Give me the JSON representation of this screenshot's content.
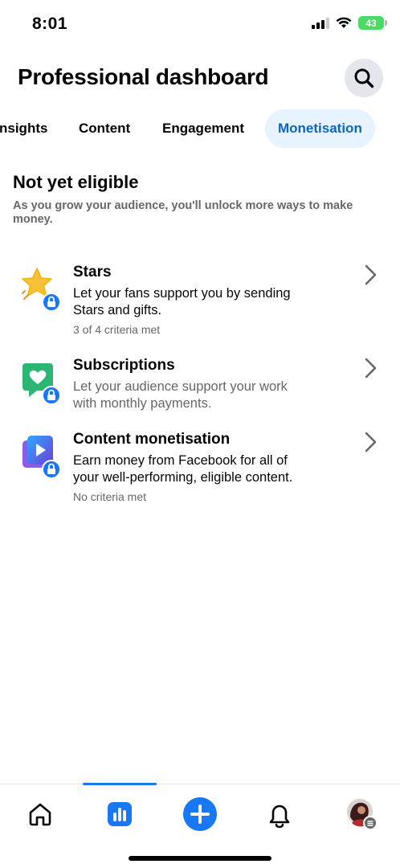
{
  "status_bar": {
    "time": "8:01",
    "battery": "43",
    "icons": [
      "cellular-signal-icon",
      "wifi-icon",
      "battery-charging-icon"
    ]
  },
  "header": {
    "title": "Professional dashboard",
    "search_icon": "search-icon"
  },
  "tabs": [
    {
      "label": "Insights",
      "visible_label": "nsights",
      "active": false
    },
    {
      "label": "Content",
      "active": false
    },
    {
      "label": "Engagement",
      "active": false
    },
    {
      "label": "Monetisation",
      "active": true
    }
  ],
  "section": {
    "title": "Not yet eligible",
    "subtitle_line1": "As you grow your audience, you'll unlock more ways to make",
    "subtitle_line2": "money."
  },
  "items": [
    {
      "title": "Stars",
      "desc_line1": "Let your fans support you by sending",
      "desc_line2": "Stars and gifts.",
      "meta": "3 of 4 criteria met",
      "icon": "star-lock-icon"
    },
    {
      "title": "Subscriptions",
      "desc_line1": "Let your audience support your work",
      "desc_line2": "with monthly payments.",
      "meta": "",
      "icon": "heart-badge-lock-icon"
    },
    {
      "title": "Content monetisation",
      "desc_line1": "Earn money from Facebook for all of",
      "desc_line2": "your well-performing, eligible content.",
      "meta": "No criteria met",
      "icon": "play-video-lock-icon"
    }
  ],
  "bottom_nav": {
    "items": [
      "home-icon",
      "dashboard-icon",
      "create-plus-icon",
      "notifications-bell-icon",
      "profile-avatar"
    ],
    "active": "dashboard-icon"
  },
  "colors": {
    "accent": "#1877f2",
    "active_tab_bg": "#e7f3ff",
    "active_tab_text": "#0a66c2",
    "secondary_text": "#65676b"
  }
}
